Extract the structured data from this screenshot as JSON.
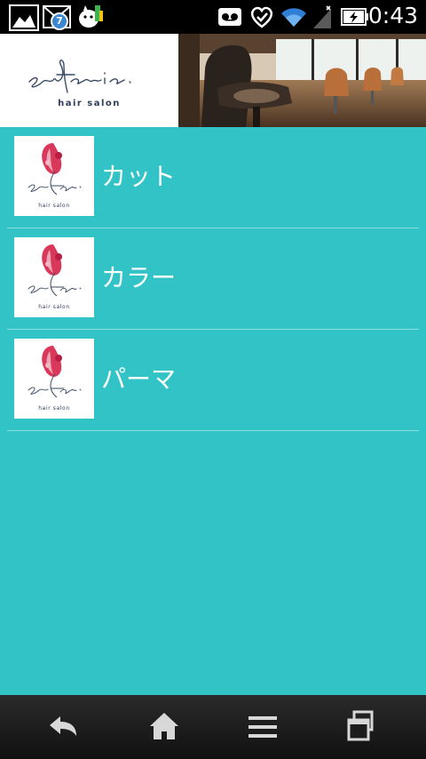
{
  "status_bar": {
    "time": "0:43",
    "notification_badge": "7",
    "icons": [
      "gallery-icon",
      "mail-icon",
      "app-dog-icon",
      "voicemail-icon",
      "heart-icon",
      "wifi-icon",
      "signal-icon",
      "battery-charging-icon"
    ]
  },
  "header": {
    "logo_script": "safari a.",
    "logo_sub": "hair salon"
  },
  "menu": {
    "items": [
      {
        "label": "カット",
        "thumb_script": "safari a.",
        "thumb_sub": "hair salon"
      },
      {
        "label": "カラー",
        "thumb_script": "safari a.",
        "thumb_sub": "hair salon"
      },
      {
        "label": "パーマ",
        "thumb_script": "safari a.",
        "thumb_sub": "hair salon"
      }
    ]
  },
  "nav": {
    "buttons": [
      "back-icon",
      "home-icon",
      "menu-icon",
      "recent-apps-icon"
    ]
  },
  "colors": {
    "content_bg": "#31c3c6",
    "status_bg": "#000000",
    "navbar_bg": "#1c1c1c"
  }
}
